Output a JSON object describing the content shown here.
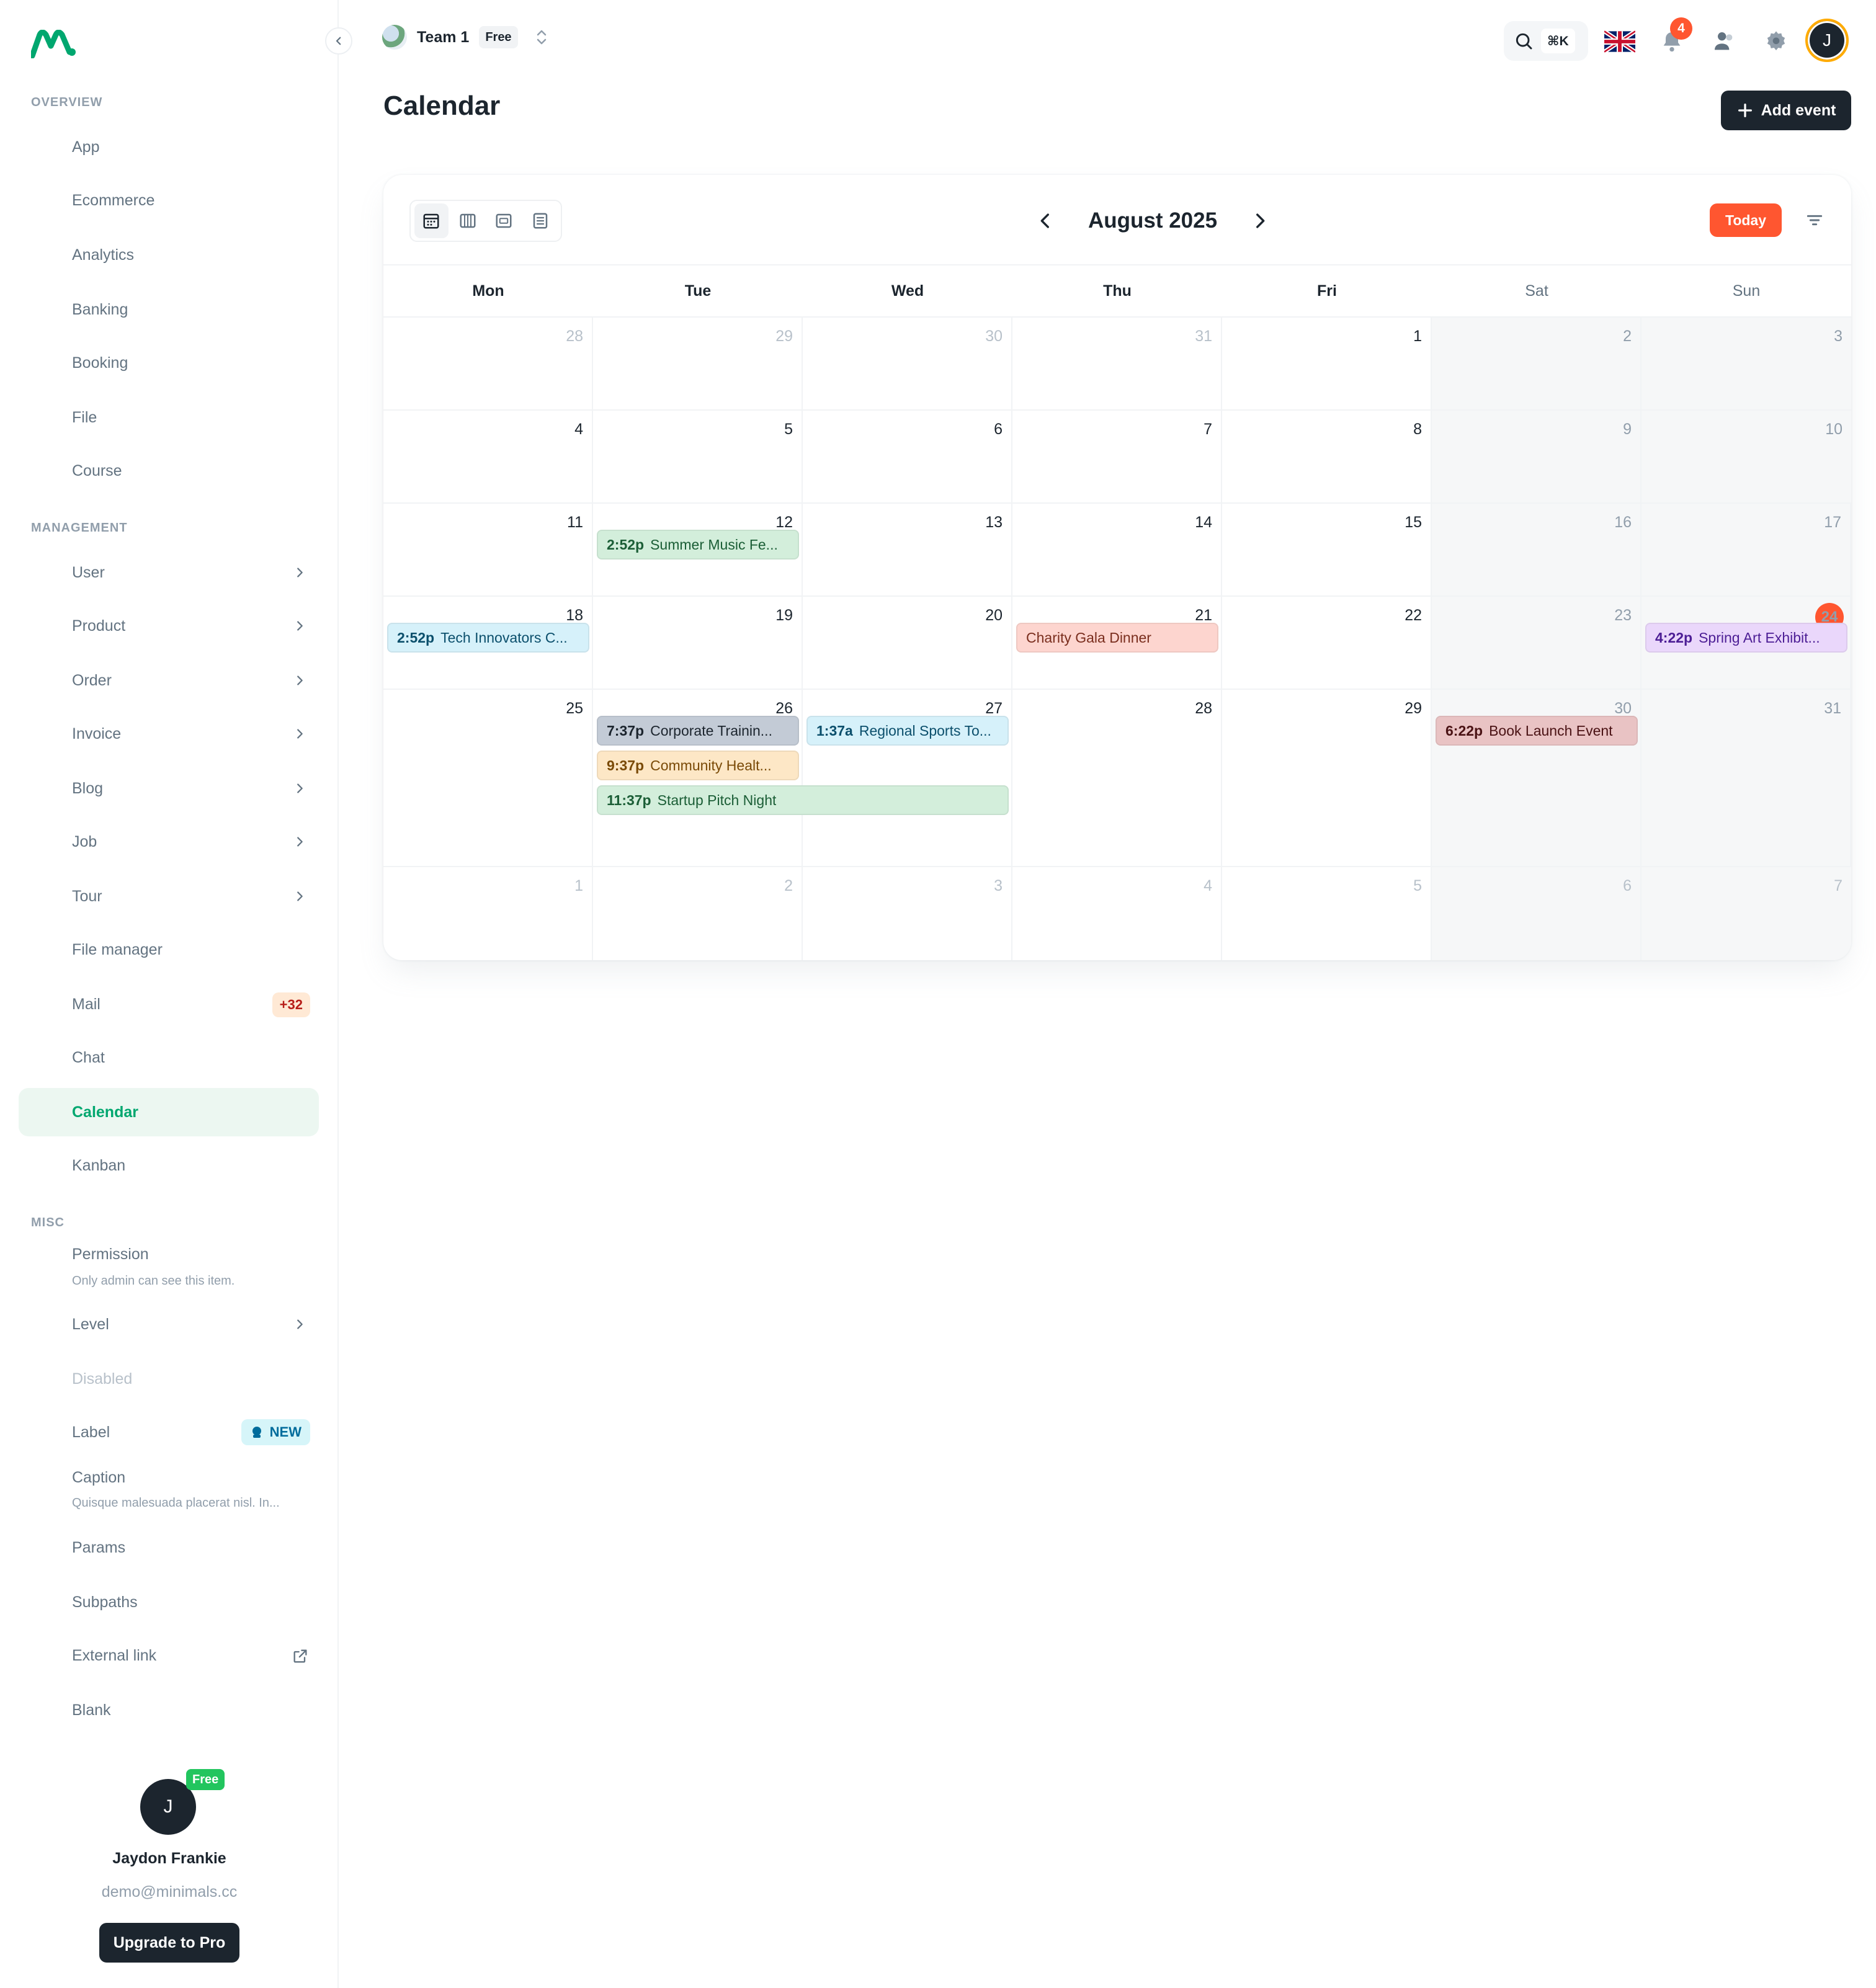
{
  "sidebar": {
    "sections": [
      {
        "title": "OVERVIEW",
        "items": [
          "App",
          "Ecommerce",
          "Analytics",
          "Banking",
          "Booking",
          "File",
          "Course"
        ]
      },
      {
        "title": "MANAGEMENT",
        "items": [
          "User",
          "Product",
          "Order",
          "Invoice",
          "Blog",
          "Job",
          "Tour",
          "File manager",
          "Mail",
          "Chat",
          "Calendar",
          "Kanban"
        ]
      },
      {
        "title": "MISC",
        "items": [
          "Permission",
          "Level",
          "Disabled",
          "Label",
          "Caption",
          "Params",
          "Subpaths",
          "External link",
          "Blank"
        ]
      }
    ],
    "overview": {
      "title": "OVERVIEW",
      "app": "App",
      "ecommerce": "Ecommerce",
      "analytics": "Analytics",
      "banking": "Banking",
      "booking": "Booking",
      "file": "File",
      "course": "Course"
    },
    "management": {
      "title": "MANAGEMENT",
      "user": "User",
      "product": "Product",
      "order": "Order",
      "invoice": "Invoice",
      "blog": "Blog",
      "job": "Job",
      "tour": "Tour",
      "file_manager": "File manager",
      "mail": "Mail",
      "mail_badge": "+32",
      "chat": "Chat",
      "calendar": "Calendar",
      "kanban": "Kanban"
    },
    "misc": {
      "title": "MISC",
      "permission": "Permission",
      "permission_caption": "Only admin can see this item.",
      "level": "Level",
      "disabled": "Disabled",
      "label": "Label",
      "label_badge": "NEW",
      "caption": "Caption",
      "caption_text": "Quisque malesuada placerat nisl. In...",
      "params": "Params",
      "subpaths": "Subpaths",
      "external_link": "External link",
      "blank": "Blank"
    },
    "active_item": "Calendar",
    "user": {
      "initial": "J",
      "plan": "Free",
      "name": "Jaydon Frankie",
      "email": "demo@minimals.cc",
      "upgrade_label": "Upgrade to Pro"
    }
  },
  "header": {
    "team_name": "Team 1",
    "team_plan": "Free",
    "search_shortcut": "⌘K",
    "notification_count": "4",
    "avatar_initial": "J",
    "icons": [
      "search-icon",
      "uk-flag-icon",
      "bell-icon",
      "contacts-icon",
      "settings-gear-icon"
    ]
  },
  "page": {
    "title": "Calendar",
    "add_event_label": "Add event"
  },
  "calendar": {
    "month_label": "August 2025",
    "today_label": "Today",
    "view_modes": [
      "month-view-icon",
      "week-view-icon",
      "day-view-icon",
      "agenda-view-icon"
    ],
    "active_view": "month",
    "weekdays": [
      "Mon",
      "Tue",
      "Wed",
      "Thu",
      "Fri",
      "Sat",
      "Sun"
    ],
    "today": "24",
    "weeks": [
      [
        {
          "d": "28",
          "other": true
        },
        {
          "d": "29",
          "other": true
        },
        {
          "d": "30",
          "other": true
        },
        {
          "d": "31",
          "other": true
        },
        {
          "d": "1"
        },
        {
          "d": "2"
        },
        {
          "d": "3"
        }
      ],
      [
        {
          "d": "4"
        },
        {
          "d": "5"
        },
        {
          "d": "6"
        },
        {
          "d": "7"
        },
        {
          "d": "8"
        },
        {
          "d": "9"
        },
        {
          "d": "10"
        }
      ],
      [
        {
          "d": "11"
        },
        {
          "d": "12"
        },
        {
          "d": "13"
        },
        {
          "d": "14"
        },
        {
          "d": "15"
        },
        {
          "d": "16"
        },
        {
          "d": "17"
        }
      ],
      [
        {
          "d": "18"
        },
        {
          "d": "19"
        },
        {
          "d": "20"
        },
        {
          "d": "21"
        },
        {
          "d": "22"
        },
        {
          "d": "23"
        },
        {
          "d": "24",
          "today": true
        }
      ],
      [
        {
          "d": "25"
        },
        {
          "d": "26"
        },
        {
          "d": "27"
        },
        {
          "d": "28"
        },
        {
          "d": "29"
        },
        {
          "d": "30"
        },
        {
          "d": "31"
        }
      ],
      [
        {
          "d": "1",
          "other": true
        },
        {
          "d": "2",
          "other": true
        },
        {
          "d": "3",
          "other": true
        },
        {
          "d": "4",
          "other": true
        },
        {
          "d": "5",
          "other": true
        },
        {
          "d": "6",
          "other": true
        },
        {
          "d": "7",
          "other": true
        }
      ]
    ],
    "events": [
      {
        "week": 2,
        "col": 1,
        "span": 1,
        "slot": 0,
        "time": "2:52p",
        "title": "Summer Music Fe...",
        "bg": "#d3eedb",
        "fg": "#1b5e36"
      },
      {
        "week": 3,
        "col": 0,
        "span": 1,
        "slot": 0,
        "time": "2:52p",
        "title": "Tech Innovators C...",
        "bg": "#d6f1fa",
        "fg": "#0b4f6c"
      },
      {
        "week": 3,
        "col": 3,
        "span": 1,
        "slot": 0,
        "time": "",
        "title": "Charity Gala Dinner",
        "bg": "#fdd5cf",
        "fg": "#7a2e1e"
      },
      {
        "week": 3,
        "col": 6,
        "span": 1,
        "slot": 0,
        "time": "4:22p",
        "title": "Spring Art Exhibit...",
        "bg": "#ead7fb",
        "fg": "#4c1d95"
      },
      {
        "week": 4,
        "col": 1,
        "span": 1,
        "slot": 0,
        "time": "7:37p",
        "title": "Corporate Trainin...",
        "bg": "#c3cbd6",
        "fg": "#1c252e"
      },
      {
        "week": 4,
        "col": 2,
        "span": 1,
        "slot": 0,
        "time": "1:37a",
        "title": "Regional Sports To...",
        "bg": "#d6f1fa",
        "fg": "#0b4f6c"
      },
      {
        "week": 4,
        "col": 5,
        "span": 1,
        "slot": 0,
        "time": "6:22p",
        "title": "Book Launch Event",
        "bg": "#e9c3c4",
        "fg": "#4a1214"
      },
      {
        "week": 4,
        "col": 1,
        "span": 1,
        "slot": 1,
        "time": "9:37p",
        "title": "Community Healt...",
        "bg": "#fde7c6",
        "fg": "#7a4a07"
      },
      {
        "week": 4,
        "col": 1,
        "span": 2,
        "slot": 2,
        "time": "11:37p",
        "title": "Startup Pitch Night",
        "bg": "#d3eedb",
        "fg": "#1b5e36"
      }
    ]
  },
  "colors": {
    "accent": "#00a76f",
    "danger": "#ff5630",
    "dark": "#1c252e"
  }
}
